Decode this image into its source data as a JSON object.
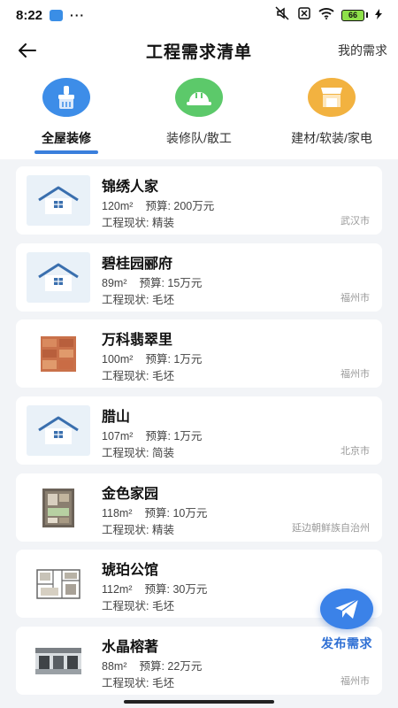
{
  "status_bar": {
    "time": "8:22",
    "dots": "···",
    "battery": "66"
  },
  "header": {
    "title": "工程需求清单",
    "right_link": "我的需求"
  },
  "categories": [
    {
      "label": "全屋装修",
      "icon": "brush-icon",
      "color": "#3d8de8",
      "active": true
    },
    {
      "label": "装修队/散工",
      "icon": "helmet-icon",
      "color": "#5cc96a",
      "active": false
    },
    {
      "label": "建材/软装/家电",
      "icon": "store-icon",
      "color": "#f2b240",
      "active": false
    }
  ],
  "list": {
    "labels": {
      "area_unit": "m²",
      "budget_prefix": "预算: ",
      "status_prefix": "工程现状: "
    },
    "items": [
      {
        "name": "锦绣人家",
        "area": "120m²",
        "budget": "预算: 200万元",
        "status": "工程现状: 精装",
        "city": "武汉市",
        "thumb": "house-icon"
      },
      {
        "name": "碧桂园郦府",
        "area": "89m²",
        "budget": "预算: 15万元",
        "status": "工程现状: 毛坯",
        "city": "福州市",
        "thumb": "house-icon"
      },
      {
        "name": "万科翡翠里",
        "area": "100m²",
        "budget": "预算: 1万元",
        "status": "工程现状: 毛坯",
        "city": "福州市",
        "thumb": "bricks-photo"
      },
      {
        "name": "腊山",
        "area": "107m²",
        "budget": "预算: 1万元",
        "status": "工程现状: 简装",
        "city": "北京市",
        "thumb": "house-icon"
      },
      {
        "name": "金色家园",
        "area": "118m²",
        "budget": "预算: 10万元",
        "status": "工程现状: 精装",
        "city": "延边朝鲜族自治州",
        "thumb": "floorplan-3d-photo"
      },
      {
        "name": "琥珀公馆",
        "area": "112m²",
        "budget": "预算: 30万元",
        "status": "工程现状: 毛坯",
        "city": "",
        "thumb": "floorplan-photo"
      },
      {
        "name": "水晶榕著",
        "area": "88m²",
        "budget": "预算: 22万元",
        "status": "工程现状: 毛坯",
        "city": "福州市",
        "thumb": "interior-photo"
      }
    ]
  },
  "fab": {
    "label": "发布需求",
    "icon": "paper-plane-icon"
  }
}
